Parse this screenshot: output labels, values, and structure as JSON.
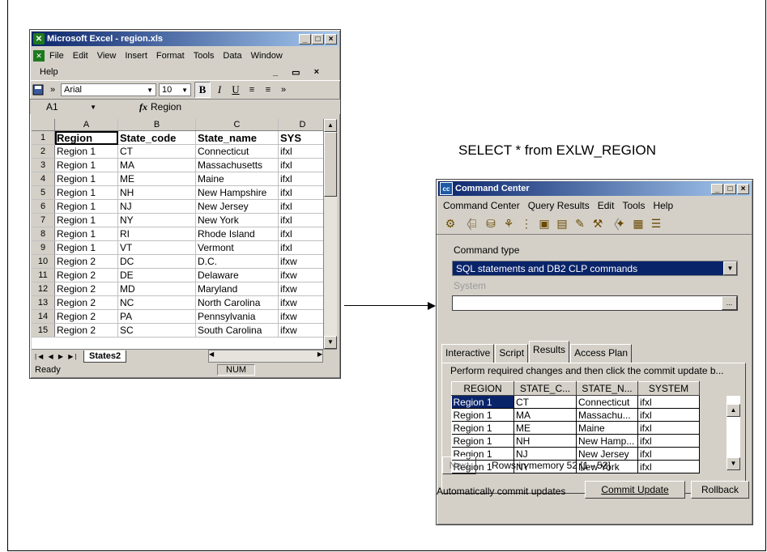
{
  "caption": "SELECT * from EXLW_REGION",
  "excel": {
    "title": "Microsoft Excel - region.xls",
    "menu": [
      "File",
      "Edit",
      "View",
      "Insert",
      "Format",
      "Tools",
      "Data",
      "Window",
      "Help"
    ],
    "font_name": "Arial",
    "font_size": "10",
    "name_box": "A1",
    "fx_symbol": "fx",
    "formula_value": "Region",
    "columns": [
      "A",
      "B",
      "C",
      "D"
    ],
    "header_row": [
      "Region",
      "State_code",
      "State_name",
      "SYS"
    ],
    "rows": [
      [
        "Region 1",
        "CT",
        "Connecticut",
        "ifxl"
      ],
      [
        "Region 1",
        "MA",
        "Massachusetts",
        "ifxl"
      ],
      [
        "Region 1",
        "ME",
        "Maine",
        "ifxl"
      ],
      [
        "Region 1",
        "NH",
        "New Hampshire",
        "ifxl"
      ],
      [
        "Region 1",
        "NJ",
        "New Jersey",
        "ifxl"
      ],
      [
        "Region 1",
        "NY",
        "New York",
        "ifxl"
      ],
      [
        "Region 1",
        "RI",
        "Rhode Island",
        "ifxl"
      ],
      [
        "Region 1",
        "VT",
        "Vermont",
        "ifxl"
      ],
      [
        "Region 2",
        "DC",
        "D.C.",
        "ifxw"
      ],
      [
        "Region 2",
        "DE",
        "Delaware",
        "ifxw"
      ],
      [
        "Region 2",
        "MD",
        "Maryland",
        "ifxw"
      ],
      [
        "Region 2",
        "NC",
        "North Carolina",
        "ifxw"
      ],
      [
        "Region 2",
        "PA",
        "Pennsylvania",
        "ifxw"
      ],
      [
        "Region 2",
        "SC",
        "South Carolina",
        "ifxw"
      ]
    ],
    "row_numbers": [
      "1",
      "2",
      "3",
      "4",
      "5",
      "6",
      "7",
      "8",
      "9",
      "10",
      "11",
      "12",
      "13",
      "14",
      "15"
    ],
    "sheet_tab": "States2",
    "status": "Ready",
    "num_indicator": "NUM"
  },
  "cc": {
    "title": "Command Center",
    "menu": [
      "Command Center",
      "Query Results",
      "Edit",
      "Tools",
      "Help"
    ],
    "command_type_label": "Command type",
    "command_type_value": "SQL statements and DB2 CLP commands",
    "system_label": "System",
    "tabs": [
      "Interactive",
      "Script",
      "Results",
      "Access Plan"
    ],
    "perform_text": "Perform required changes and then click the commit update b...",
    "result_columns": [
      "REGION",
      "STATE_C...",
      "STATE_N...",
      "SYSTEM"
    ],
    "result_rows": [
      [
        "Region 1",
        "CT",
        "Connecticut",
        "ifxl"
      ],
      [
        "Region 1",
        "MA",
        "Massachu...",
        "ifxl"
      ],
      [
        "Region 1",
        "ME",
        "Maine",
        "ifxl"
      ],
      [
        "Region 1",
        "NH",
        "New Hamp...",
        "ifxl"
      ],
      [
        "Region 1",
        "NJ",
        "New Jersey",
        "ifxl"
      ],
      [
        "Region 1",
        "NY",
        "New York",
        "ifxl"
      ]
    ],
    "next_label": "Next",
    "rows_in_memory": "Rows in memory  52  [1 - 52]",
    "auto_commit": "Automatically commit updates",
    "commit_label": "Commit Update",
    "rollback_label": "Rollback"
  }
}
